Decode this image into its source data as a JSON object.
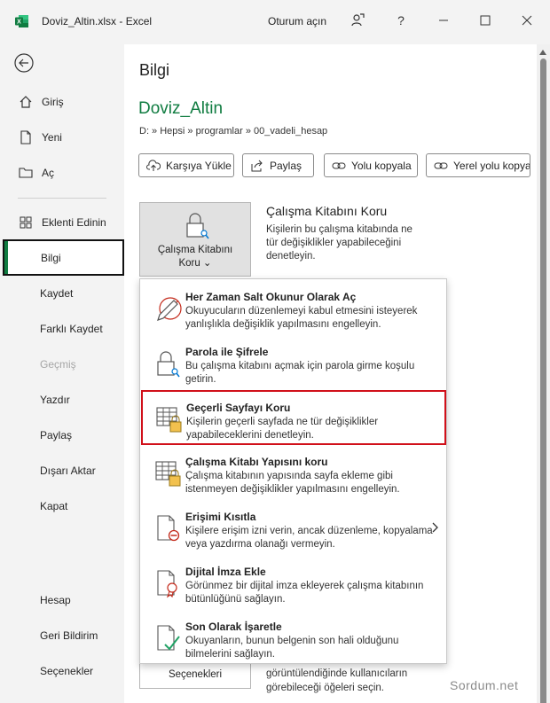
{
  "titlebar": {
    "title": "Doviz_Altin.xlsx  -  Excel",
    "signin": "Oturum açın",
    "help": "?"
  },
  "sidebar": {
    "items": [
      {
        "id": "home",
        "label": "Giriş",
        "icon": "home-icon"
      },
      {
        "id": "new",
        "label": "Yeni",
        "icon": "new-document-icon"
      },
      {
        "id": "open",
        "label": "Aç",
        "icon": "folder-icon"
      },
      {
        "id": "addins",
        "label": "Eklenti Edinin",
        "icon": "grid-icon"
      },
      {
        "id": "info",
        "label": "Bilgi",
        "selected": true
      },
      {
        "id": "save",
        "label": "Kaydet"
      },
      {
        "id": "saveas",
        "label": "Farklı Kaydet"
      },
      {
        "id": "history",
        "label": "Geçmiş",
        "disabled": true
      },
      {
        "id": "print",
        "label": "Yazdır"
      },
      {
        "id": "share",
        "label": "Paylaş"
      },
      {
        "id": "export",
        "label": "Dışarı Aktar"
      },
      {
        "id": "close",
        "label": "Kapat"
      },
      {
        "id": "account",
        "label": "Hesap"
      },
      {
        "id": "feedback",
        "label": "Geri Bildirim"
      },
      {
        "id": "options",
        "label": "Seçenekler"
      }
    ]
  },
  "main": {
    "heading": "Bilgi",
    "docname": "Doviz_Altin",
    "path": "D: » Hepsi » programlar » 00_vadeli_hesap",
    "actions": [
      {
        "label": "Karşıya Yükle",
        "icon": "upload-icon"
      },
      {
        "label": "Paylaş",
        "icon": "share-icon"
      },
      {
        "label": "Yolu kopyala",
        "icon": "link-icon"
      },
      {
        "label": "Yerel yolu kopya",
        "icon": "link-icon"
      }
    ],
    "protect": {
      "button_line1": "Çalışma Kitabını",
      "button_line2": "Koru ⌄",
      "title": "Çalışma Kitabını Koru",
      "desc": "Kişilerin bu çalışma kitabında ne tür değişiklikler yapabileceğini denetleyin."
    },
    "bottom": {
      "button_label": "Seçenekleri",
      "desc": "görüntülendiğinde kullanıcıların görebileceği öğeleri seçin."
    }
  },
  "dropdown": {
    "items": [
      {
        "title": "Her Zaman Salt Okunur Olarak Aç",
        "desc": "Okuyucuların düzenlemeyi kabul etmesini isteyerek yanlışlıkla değişiklik yapılmasını engelleyin.",
        "icon": "read-only-pencil-icon"
      },
      {
        "title": "Parola ile Şifrele",
        "desc": "Bu çalışma kitabını açmak için parola girme koşulu getirin.",
        "icon": "password-lock-icon"
      },
      {
        "title": "Geçerli Sayfayı Koru",
        "desc": "Kişilerin geçerli sayfada ne tür değişiklikler yapabileceklerini denetleyin.",
        "icon": "sheet-lock-icon",
        "highlighted": true
      },
      {
        "title": "Çalışma Kitabı Yapısını koru",
        "desc": "Çalışma kitabının yapısında sayfa ekleme gibi istenmeyen değişiklikler yapılmasını engelleyin.",
        "icon": "workbook-structure-lock-icon"
      },
      {
        "title": "Erişimi Kısıtla",
        "desc": "Kişilere erişim izni verin, ancak düzenleme, kopyalama veya yazdırma olanağı vermeyin.",
        "icon": "restrict-access-icon",
        "submenu": true
      },
      {
        "title": "Dijital İmza Ekle",
        "desc": "Görünmez bir dijital imza ekleyerek çalışma kitabının bütünlüğünü sağlayın.",
        "icon": "digital-signature-icon"
      },
      {
        "title": "Son Olarak İşaretle",
        "desc": "Okuyanların, bunun belgenin son hali olduğunu bilmelerini sağlayın.",
        "icon": "mark-final-icon"
      }
    ]
  },
  "watermark": "Sordum.net",
  "colors": {
    "accent": "#107c41",
    "highlight": "#d1101a",
    "sidebar_bg": "#f3f3f3"
  }
}
